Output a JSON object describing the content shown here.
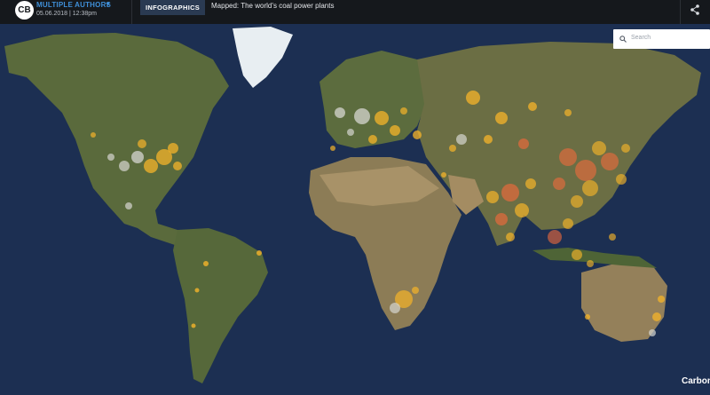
{
  "header": {
    "logo": "CB",
    "authors": "MULTIPLE AUTHORS",
    "date": "05.06.2018 | 12:38pm",
    "badge": "INFOGRAPHICS",
    "headline": "Mapped: The world’s coal power plants"
  },
  "search": {
    "placeholder": "Search"
  },
  "brand": "Carbon",
  "colors": {
    "ocean": "#1c2f52",
    "land": "#5a6a3c",
    "desert": "#9a8662",
    "ice": "#e8eef2",
    "plant_operating": "#f5b42a",
    "plant_large": "#f06a3c",
    "plant_retired": "#d6d6d0"
  },
  "icons": [
    "caret-down-icon",
    "share-icon",
    "search-icon"
  ]
}
